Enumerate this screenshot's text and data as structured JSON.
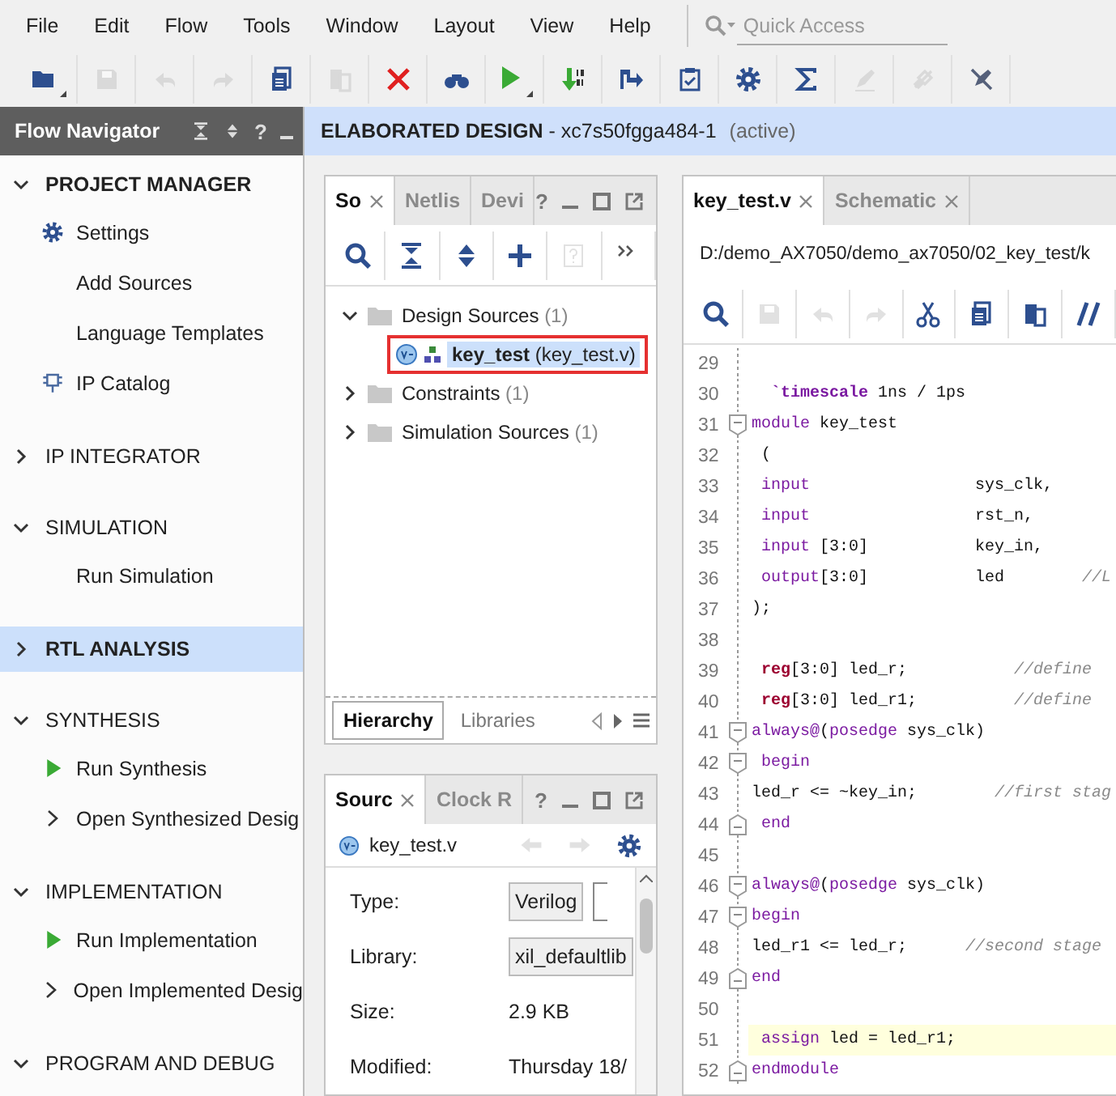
{
  "menu": [
    "File",
    "Edit",
    "Flow",
    "Tools",
    "Window",
    "Layout",
    "View",
    "Help"
  ],
  "quick_access": {
    "placeholder": "Quick Access"
  },
  "toolbar": [
    {
      "kind": "folder",
      "disabled": false,
      "dropdown": true
    },
    {
      "kind": "save",
      "disabled": true,
      "dropdown": false
    },
    {
      "kind": "undo",
      "disabled": true,
      "dropdown": false
    },
    {
      "kind": "redo",
      "disabled": true,
      "dropdown": false
    },
    {
      "kind": "document",
      "disabled": false,
      "dropdown": false
    },
    {
      "kind": "paste",
      "disabled": true,
      "dropdown": false
    },
    {
      "kind": "cross",
      "disabled": false,
      "dropdown": false
    },
    {
      "kind": "binoculars",
      "disabled": false,
      "dropdown": false
    },
    {
      "kind": "play",
      "disabled": false,
      "dropdown": true
    },
    {
      "kind": "download",
      "disabled": false,
      "dropdown": false
    },
    {
      "kind": "step",
      "disabled": false,
      "dropdown": false
    },
    {
      "kind": "clipboard",
      "disabled": false,
      "dropdown": false
    },
    {
      "kind": "settings",
      "disabled": false,
      "dropdown": false
    },
    {
      "kind": "sigma",
      "disabled": false,
      "dropdown": false
    },
    {
      "kind": "pencil",
      "disabled": true,
      "dropdown": false
    },
    {
      "kind": "link",
      "disabled": true,
      "dropdown": false
    },
    {
      "kind": "strike",
      "disabled": false,
      "dropdown": false
    }
  ],
  "flow_navigator": {
    "title": "Flow Navigator",
    "help": "?",
    "sections": [
      {
        "label": "PROJECT MANAGER",
        "expanded": true,
        "selected": false,
        "bold": true,
        "items": [
          {
            "label": "Settings",
            "kind": "settings"
          },
          {
            "label": "Add Sources",
            "kind": "plain"
          },
          {
            "label": "Language Templates",
            "kind": "plain"
          },
          {
            "label": "IP Catalog",
            "kind": "chip"
          }
        ]
      },
      {
        "label": "IP INTEGRATOR",
        "expanded": false,
        "selected": false,
        "bold": false
      },
      {
        "label": "SIMULATION",
        "expanded": true,
        "selected": false,
        "bold": false,
        "items": [
          {
            "label": "Run Simulation",
            "kind": "plain"
          }
        ]
      },
      {
        "label": "RTL ANALYSIS",
        "expanded": false,
        "selected": true,
        "bold": true
      },
      {
        "label": "SYNTHESIS",
        "expanded": true,
        "selected": false,
        "bold": false,
        "items": [
          {
            "label": "Run Synthesis",
            "kind": "run"
          },
          {
            "label": "Open Synthesized Desig",
            "kind": "expandable"
          }
        ]
      },
      {
        "label": "IMPLEMENTATION",
        "expanded": true,
        "selected": false,
        "bold": false,
        "items": [
          {
            "label": "Run Implementation",
            "kind": "run"
          },
          {
            "label": "Open Implemented Desig",
            "kind": "expandable"
          }
        ]
      },
      {
        "label": "PROGRAM AND DEBUG",
        "expanded": true,
        "selected": false,
        "bold": false
      }
    ]
  },
  "design_banner": {
    "title": "**ELABORATED DESIGN** - xc7s50fgga484-1",
    "status": "(active)"
  },
  "sources_panel": {
    "help": "?",
    "tabs": [
      {
        "label": "So",
        "selected": true,
        "closable": true
      },
      {
        "label": "Netlis",
        "selected": false,
        "closable": false
      },
      {
        "label": "Devi",
        "selected": false,
        "closable": false
      }
    ],
    "toolbar": [
      {
        "kind": "search",
        "disabled": false
      },
      {
        "kind": "collapse",
        "disabled": false
      },
      {
        "kind": "expand",
        "disabled": false
      },
      {
        "kind": "plus",
        "disabled": false
      },
      {
        "kind": "help",
        "disabled": true
      },
      {
        "kind": "more",
        "disabled": false
      }
    ],
    "tree": [
      {
        "label": "Design Sources",
        "count": "(1)",
        "expanded": true,
        "children": [
          {
            "label": "key_test",
            "detail": "(key_test.v)",
            "selected": true,
            "highlighted": true
          }
        ]
      },
      {
        "label": "Constraints",
        "count": "(1)",
        "expanded": false
      },
      {
        "label": "Simulation Sources",
        "count": "(1)",
        "expanded": false
      }
    ],
    "bottom_tabs": [
      {
        "label": "Hierarchy",
        "selected": true
      },
      {
        "label": "Libraries",
        "selected": false
      }
    ]
  },
  "properties_panel": {
    "help": "?",
    "tabs": [
      {
        "label": "Sourc",
        "selected": true,
        "closable": true
      },
      {
        "label": "Clock R",
        "selected": false,
        "closable": false
      }
    ],
    "file": "key_test.v",
    "rows": [
      {
        "label": "Type:",
        "value": "Verilog",
        "kind": "field"
      },
      {
        "label": "Library:",
        "value": "xil_defaultlib",
        "kind": "field"
      },
      {
        "label": "Size:",
        "value": "2.9 KB",
        "kind": "text"
      },
      {
        "label": "Modified:",
        "value": "Thursday 18/",
        "kind": "text"
      }
    ]
  },
  "editor": {
    "tabs": [
      {
        "label": "key_test.v",
        "selected": true,
        "closable": true
      },
      {
        "label": "Schematic",
        "selected": false,
        "closable": true
      }
    ],
    "path": "D:/demo_AX7050/demo_ax7050/02_key_test/k",
    "toolbar": [
      {
        "kind": "search",
        "disabled": false
      },
      {
        "kind": "save",
        "disabled": true
      },
      {
        "kind": "undo",
        "disabled": true
      },
      {
        "kind": "redo",
        "disabled": true
      },
      {
        "kind": "cut",
        "disabled": false
      },
      {
        "kind": "document",
        "disabled": false
      },
      {
        "kind": "paste",
        "disabled": false
      },
      {
        "kind": "comment",
        "disabled": false
      }
    ],
    "lines": [
      {
        "number": "29",
        "kind": "plain",
        "highlighted": false
      },
      {
        "number": "30",
        "kind": "plain",
        "highlighted": false,
        "tokens": [
          {
            "text": "  `timescale",
            "kind": "directive"
          },
          {
            "text": " 1ns / 1ps",
            "kind": "plain"
          }
        ]
      },
      {
        "number": "31",
        "kind": "opener",
        "highlighted": false,
        "tokens": [
          {
            "text": "module",
            "kind": "keyword"
          },
          {
            "text": " key_test",
            "kind": "plain"
          }
        ]
      },
      {
        "number": "32",
        "kind": "plain",
        "highlighted": false,
        "tokens": [
          {
            "text": " (",
            "kind": "plain"
          }
        ]
      },
      {
        "number": "33",
        "kind": "plain",
        "highlighted": false,
        "tokens": [
          {
            "text": " input",
            "kind": "keyword"
          },
          {
            "text": "                 sys_clk,",
            "kind": "plain"
          }
        ]
      },
      {
        "number": "34",
        "kind": "plain",
        "highlighted": false,
        "tokens": [
          {
            "text": " input",
            "kind": "keyword"
          },
          {
            "text": "                 rst_n,",
            "kind": "plain"
          }
        ]
      },
      {
        "number": "35",
        "kind": "plain",
        "highlighted": false,
        "tokens": [
          {
            "text": " input",
            "kind": "keyword"
          },
          {
            "text": " [3:0]           key_in,",
            "kind": "plain"
          }
        ]
      },
      {
        "number": "36",
        "kind": "plain",
        "highlighted": false,
        "tokens": [
          {
            "text": " output",
            "kind": "keyword"
          },
          {
            "text": "[3:0]           led        ",
            "kind": "plain"
          },
          {
            "text": "//L",
            "kind": "comment"
          }
        ]
      },
      {
        "number": "37",
        "kind": "plain",
        "highlighted": false,
        "tokens": [
          {
            "text": ");",
            "kind": "plain"
          }
        ]
      },
      {
        "number": "38",
        "kind": "plain",
        "highlighted": false
      },
      {
        "number": "39",
        "kind": "plain",
        "highlighted": false,
        "tokens": [
          {
            "text": " reg",
            "kind": "type"
          },
          {
            "text": "[3:0] led_r;           ",
            "kind": "plain"
          },
          {
            "text": "//define",
            "kind": "comment"
          }
        ]
      },
      {
        "number": "40",
        "kind": "plain",
        "highlighted": false,
        "tokens": [
          {
            "text": " reg",
            "kind": "type"
          },
          {
            "text": "[3:0] led_r1;          ",
            "kind": "plain"
          },
          {
            "text": "//define",
            "kind": "comment"
          }
        ]
      },
      {
        "number": "41",
        "kind": "opener",
        "highlighted": false,
        "tokens": [
          {
            "text": "always@",
            "kind": "keyword"
          },
          {
            "text": "(",
            "kind": "plain"
          },
          {
            "text": "posedge",
            "kind": "keyword"
          },
          {
            "text": " sys_clk)",
            "kind": "plain"
          }
        ]
      },
      {
        "number": "42",
        "kind": "opener",
        "highlighted": false,
        "tokens": [
          {
            "text": " begin",
            "kind": "keyword"
          }
        ]
      },
      {
        "number": "43",
        "kind": "plain",
        "highlighted": false,
        "tokens": [
          {
            "text": "led_r <= ~key_in;        ",
            "kind": "plain"
          },
          {
            "text": "//first stag",
            "kind": "comment"
          }
        ]
      },
      {
        "number": "44",
        "kind": "closer",
        "highlighted": false,
        "tokens": [
          {
            "text": " end",
            "kind": "keyword"
          }
        ]
      },
      {
        "number": "45",
        "kind": "plain",
        "highlighted": false
      },
      {
        "number": "46",
        "kind": "opener",
        "highlighted": false,
        "tokens": [
          {
            "text": "always@",
            "kind": "keyword"
          },
          {
            "text": "(",
            "kind": "plain"
          },
          {
            "text": "posedge",
            "kind": "keyword"
          },
          {
            "text": " sys_clk)",
            "kind": "plain"
          }
        ]
      },
      {
        "number": "47",
        "kind": "opener",
        "highlighted": false,
        "tokens": [
          {
            "text": "begin",
            "kind": "keyword"
          }
        ]
      },
      {
        "number": "48",
        "kind": "plain",
        "highlighted": false,
        "tokens": [
          {
            "text": "led_r1 <= led_r;      ",
            "kind": "plain"
          },
          {
            "text": "//second stage",
            "kind": "comment"
          }
        ]
      },
      {
        "number": "49",
        "kind": "closer",
        "highlighted": false,
        "tokens": [
          {
            "text": "end",
            "kind": "keyword"
          }
        ]
      },
      {
        "number": "50",
        "kind": "plain",
        "highlighted": false
      },
      {
        "number": "51",
        "kind": "plain",
        "highlighted": true,
        "tokens": [
          {
            "text": " assign",
            "kind": "keyword"
          },
          {
            "text": " led = led_r1;",
            "kind": "plain"
          }
        ]
      },
      {
        "number": "52",
        "kind": "closer",
        "highlighted": false,
        "tokens": [
          {
            "text": "endmodule",
            "kind": "keyword"
          }
        ]
      }
    ]
  }
}
